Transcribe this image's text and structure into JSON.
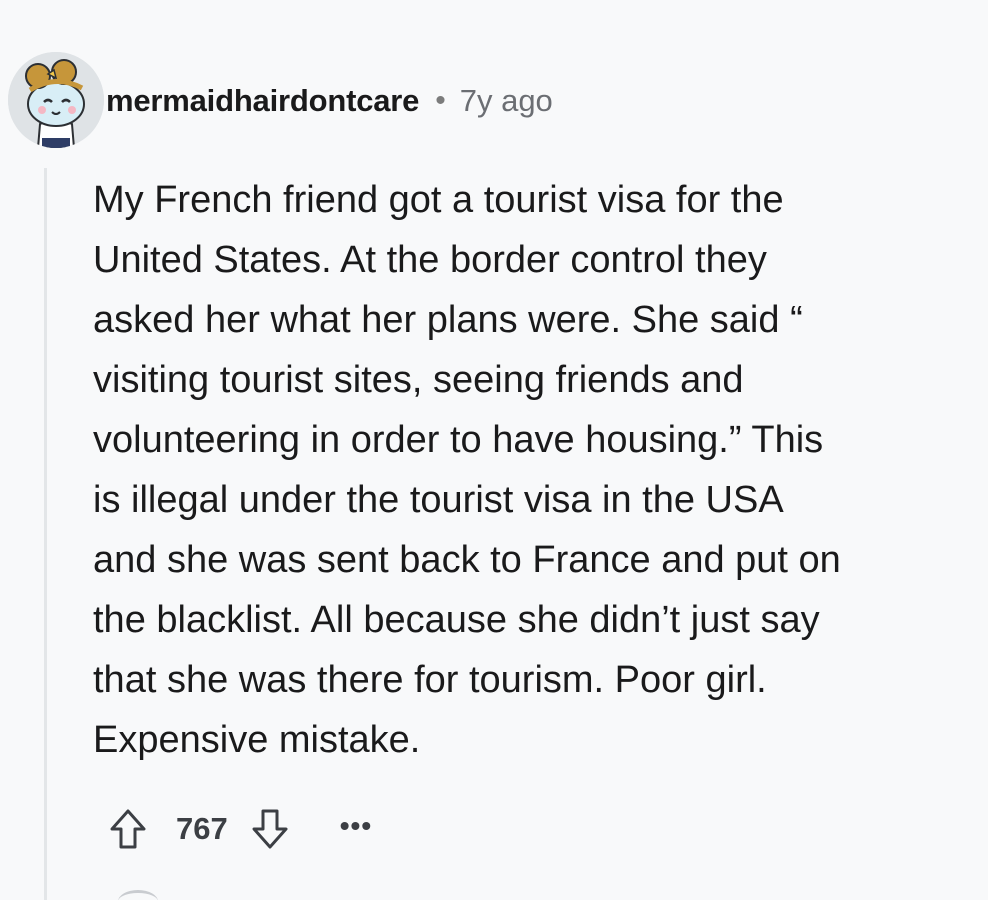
{
  "comment": {
    "author": "mermaidhairdontcare",
    "separator": "•",
    "timestamp": "7y ago",
    "body": "My French friend got a tourist visa for the\nUnited States. At the border control they\nasked her what her plans were. She said “\nvisiting tourist sites, seeing friends and\nvolunteering in order to have housing.” This\nis illegal under the tourist visa in the USA\nand she was sent back to France and put on\nthe blacklist. All because she didn’t just say\nthat she was there for tourism. Poor girl.\nExpensive mistake.",
    "score": "767",
    "more_label": "•••"
  },
  "icons": {
    "upvote": "upvote-arrow-icon",
    "downvote": "downvote-arrow-icon",
    "avatar": "snoo-avatar"
  },
  "colors": {
    "background": "#f8f9fa",
    "text": "#1a1a1b",
    "muted": "#6b6e73",
    "thread_line": "#e3e6e8"
  }
}
